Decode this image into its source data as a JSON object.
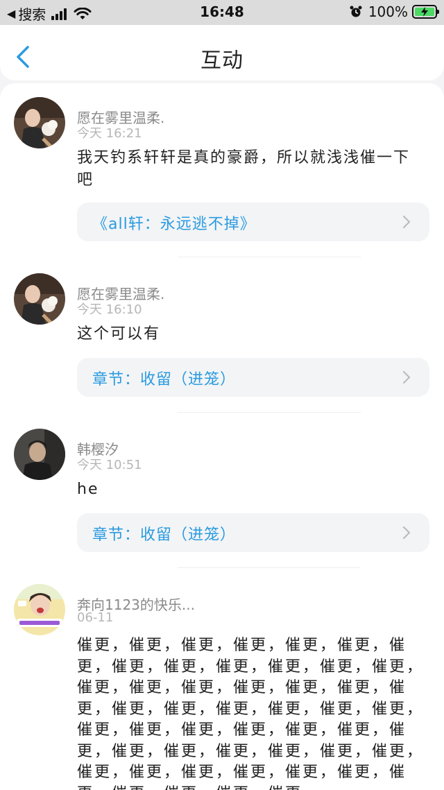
{
  "status_bar": {
    "back_glyph": "◀",
    "carrier": "搜索",
    "time": "16:48",
    "battery_text": "100%"
  },
  "nav": {
    "title": "互动",
    "back_icon": "chevron-left-icon"
  },
  "colors": {
    "accent_link": "#2a9be0",
    "back_arrow": "#2a9be0",
    "battery_fill": "#4cd964"
  },
  "comments": [
    {
      "username": "愿在雾里温柔.",
      "time": "今天 16:21",
      "text": "我天钓系轩轩是真的豪爵，所以就浅浅催一下吧",
      "link": "《all轩：永远逃不掉》"
    },
    {
      "username": "愿在雾里温柔.",
      "time": "今天 16:10",
      "text": "这个可以有",
      "link": "章节：收留（进笼）"
    },
    {
      "username": "韩樱汐",
      "time": "今天 10:51",
      "text": "he",
      "link": "章节：收留（进笼）"
    },
    {
      "username": "奔向1123的快乐...",
      "time": "06-11",
      "text": "催更，催更，催更，催更，催更，催更，催更，催更，催更，催更，催更，催更，催更，催更，催更，催更，催更，催更，催更，催更，催更，催更，催更，催更，催更，催更，催更，催更，催更，催更，催更，催更，催更，催更，催更，催更，催更，催更，催更，催更，催更，催更，催更，催更，催更，催更，催更，催更，催更，催更，"
    }
  ]
}
